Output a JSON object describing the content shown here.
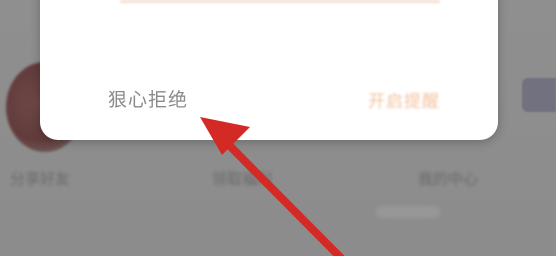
{
  "background": {
    "labels": [
      "分享好友",
      "领取福利",
      "我的中心"
    ]
  },
  "dialog": {
    "reject_label": "狠心拒绝",
    "confirm_label": "开启提醒"
  },
  "annotation": {
    "arrow_color": "#d42a26",
    "icon": "red-arrow-icon"
  }
}
